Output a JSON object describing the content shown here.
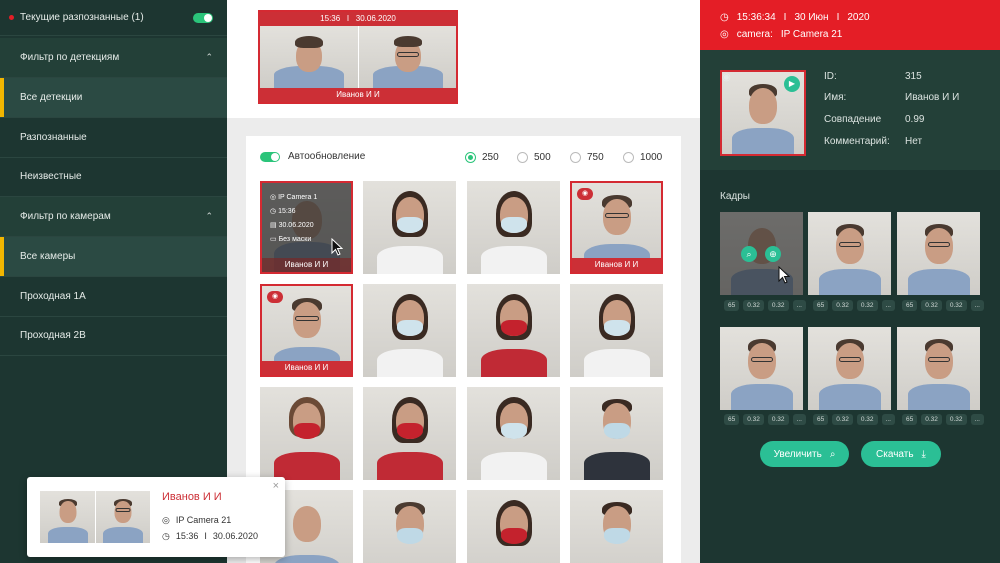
{
  "sidebar": {
    "current_recognized": "Текущие разпознанные (1)",
    "detection_filter": "Фильтр по детекциям",
    "detection_items": [
      "Все детекции",
      "Разпознанные",
      "Неизвестные"
    ],
    "camera_filter": "Фильтр по камерам",
    "camera_items": [
      "Все камеры",
      "Проходная 1А",
      "Проходная 2В"
    ]
  },
  "top_card": {
    "time": "15:36",
    "separator": "I",
    "date": "30.06.2020",
    "name": "Иванов И И"
  },
  "panel": {
    "autoupdate_label": "Автообновление",
    "counts": [
      "250",
      "500",
      "750",
      "1000"
    ],
    "selected_count": "250"
  },
  "hover_tile": {
    "camera": "IP Camera 1",
    "time": "15:36",
    "date": "30.06.2020",
    "mask": "Без маски",
    "name": "Иванов И И"
  },
  "tiles": {
    "selected_name": "Иванов И И"
  },
  "right": {
    "time": "15:36:34",
    "sep": "I",
    "day": "30 Июн",
    "year": "2020",
    "camera_label": "camera:",
    "camera_value": "IP Camera 21",
    "id_label": "ID:",
    "id_value": "315",
    "name_label": "Имя:",
    "name_value": "Иванов И И",
    "match_label": "Совпадение",
    "match_value": "0.99",
    "comment_label": "Комментарий:",
    "comment_value": "Нет",
    "frames_title": "Кадры",
    "chip_values": [
      "65",
      "0.32",
      "0.32",
      "..."
    ],
    "zoom_button": "Увеличить",
    "download_button": "Скачать"
  },
  "toast": {
    "name": "Иванов И И",
    "camera": "IP Camera 21",
    "time": "15:36",
    "sep": "I",
    "date": "30.06.2020",
    "close": "×"
  },
  "colors": {
    "accent_red": "#e41e26",
    "accent_green": "#2bc47a",
    "sidebar_bg": "#1d3631",
    "active_marker": "#f2b600"
  }
}
